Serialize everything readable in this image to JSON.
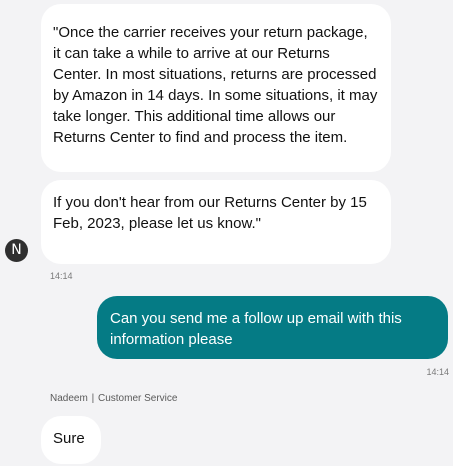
{
  "messages": {
    "agent_message_1": "\"Once the carrier receives your return package, it can take a while to arrive at our Returns Center. In most situations, returns are processed by Amazon in 14 days. In some situations, it may take longer. This additional time allows our Returns Center to find and process the item.",
    "agent_message_2": "If you don't hear from our Returns Center by 15 Feb, 2023, please let us know.\"",
    "agent_timestamp": "14:14",
    "user_message": "Can you send me a follow up email with this information please",
    "user_timestamp": "14:14",
    "agent_message_3": "Sure"
  },
  "agent": {
    "avatar_initial": "N",
    "name": "Nadeem",
    "separator": "|",
    "role": "Customer Service"
  },
  "colors": {
    "user_bubble": "#057b85",
    "agent_bubble": "#ffffff",
    "background": "#f3f3f5"
  }
}
